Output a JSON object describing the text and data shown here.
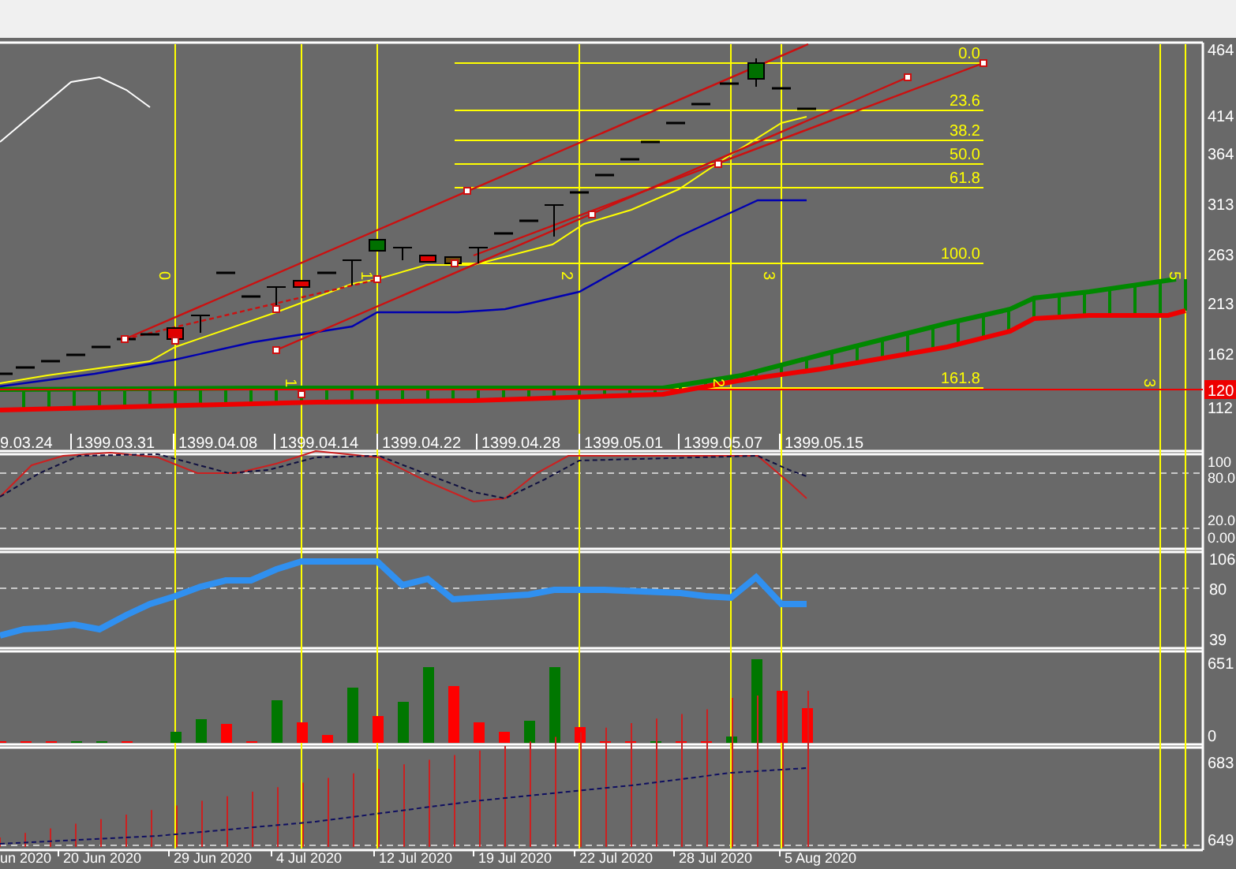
{
  "main_pane": {
    "dates": [
      "9.03.24",
      "1399.03.31",
      "1399.04.08",
      "1399.04.14",
      "1399.04.22",
      "1399.04.28",
      "1399.05.01",
      "1399.05.07",
      "1399.05.15"
    ],
    "price_axis": [
      "464",
      "414",
      "364",
      "313",
      "263",
      "213",
      "162",
      "112"
    ],
    "price_badge": "120",
    "fib_levels": [
      "0.0",
      "23.6",
      "38.2",
      "50.0",
      "61.8",
      "100.0",
      "161.8"
    ],
    "wave_labels": [
      "0",
      "1",
      "1",
      "2",
      "2",
      "3",
      "3",
      "5"
    ]
  },
  "oscillator_pane": {
    "axis": [
      "100",
      "80.0",
      "20.0",
      "0.00"
    ]
  },
  "line_pane": {
    "axis": [
      "106",
      "80",
      "39"
    ]
  },
  "volume_pane": {
    "axis": [
      "651",
      "0"
    ]
  },
  "bottom_pane": {
    "axis": [
      "683",
      "649"
    ],
    "dates": [
      "un 2020",
      "20 Jun 2020",
      "29 Jun 2020",
      "4 Jul 2020",
      "12 Jul 2020",
      "19 Jul 2020",
      "22 Jul 2020",
      "28 Jul 2020",
      "5 Aug 2020"
    ]
  }
}
